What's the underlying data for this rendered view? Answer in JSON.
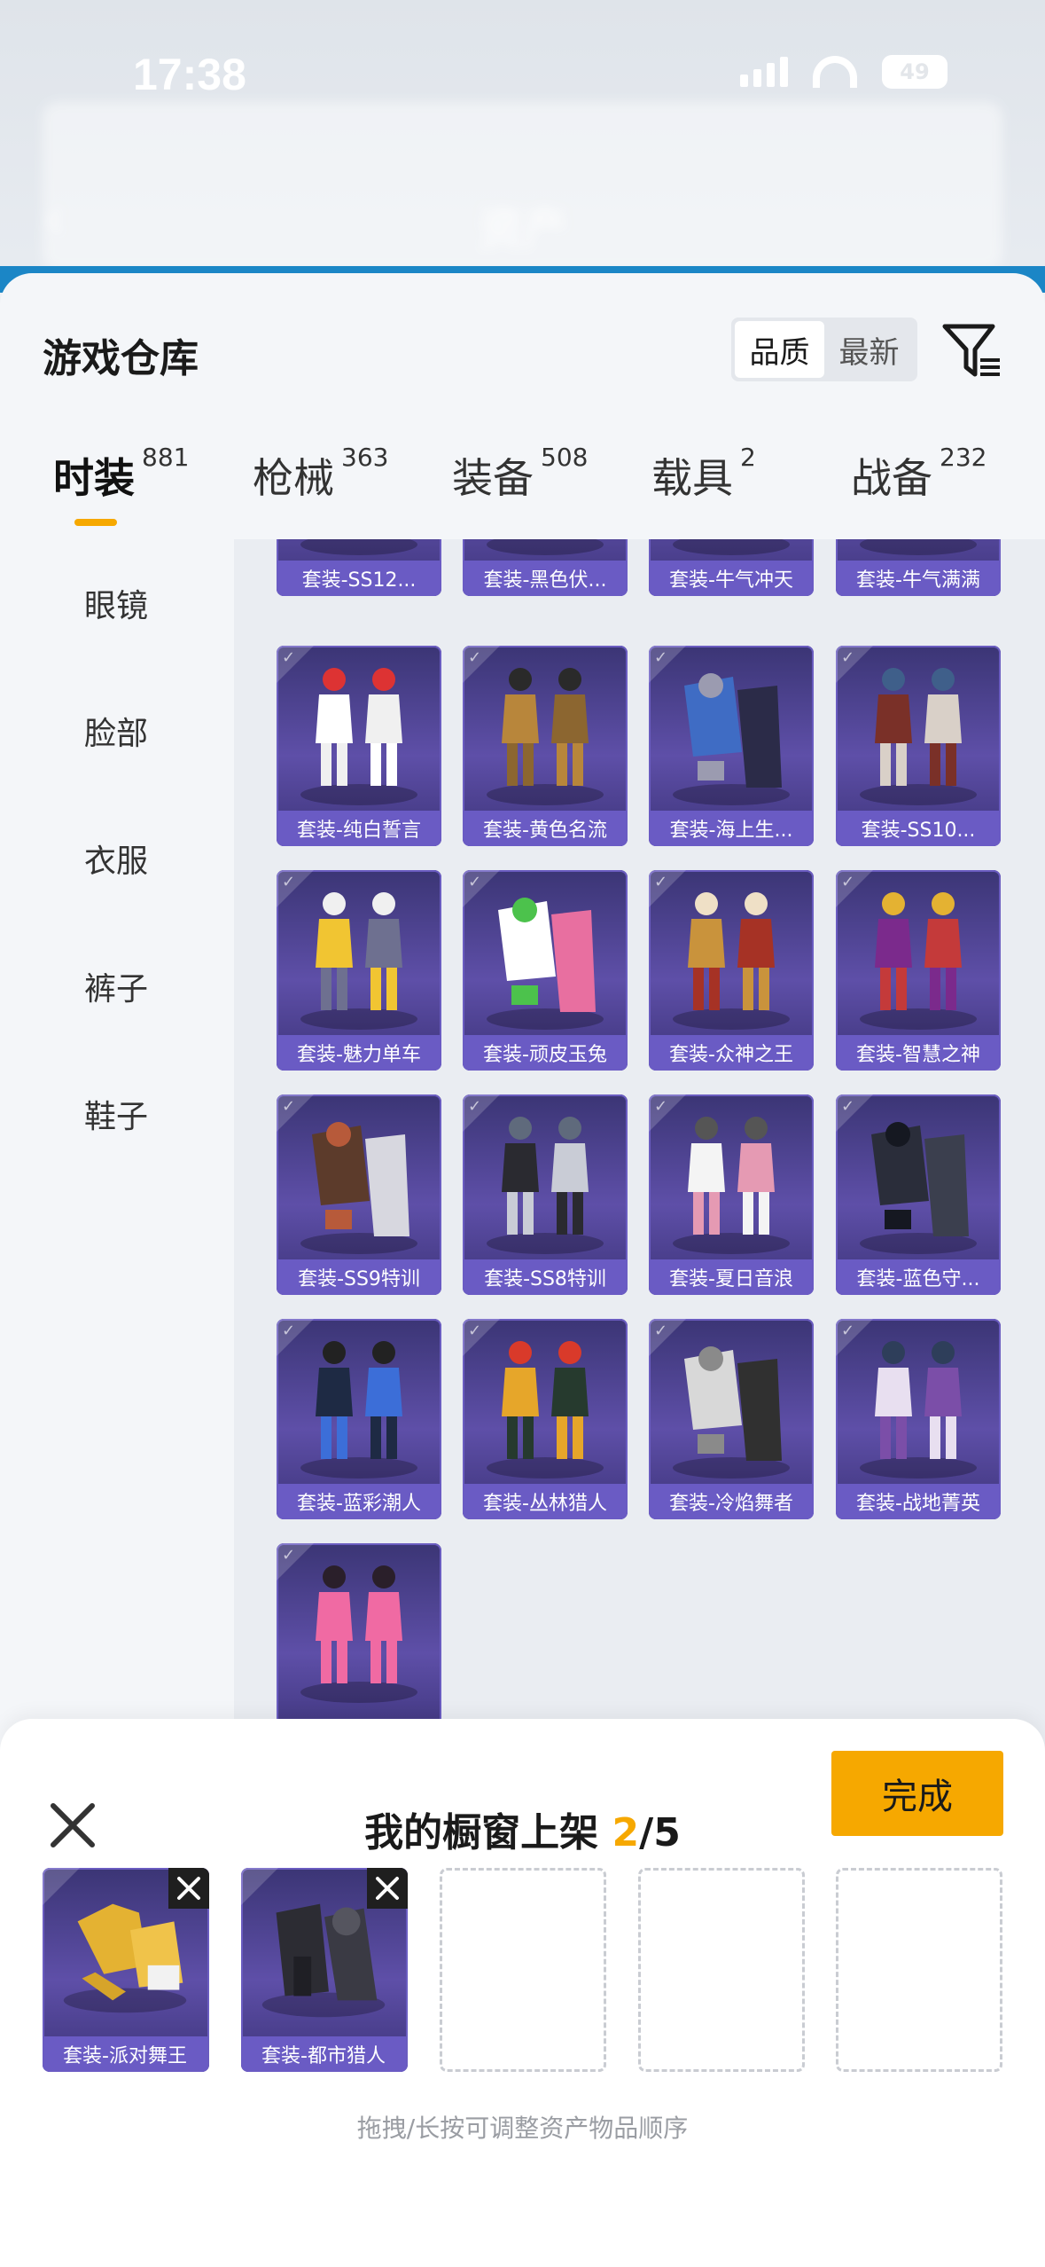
{
  "status": {
    "time": "17:38",
    "battery": "49"
  },
  "background": {
    "page_title": "资产"
  },
  "header": {
    "title": "游戏仓库",
    "sort_options": [
      "品质",
      "最新"
    ],
    "active_sort": "品质"
  },
  "tabs": [
    {
      "label": "时装",
      "count": "881",
      "active": true
    },
    {
      "label": "枪械",
      "count": "363"
    },
    {
      "label": "装备",
      "count": "508"
    },
    {
      "label": "载具",
      "count": "2"
    },
    {
      "label": "战备",
      "count": "232"
    }
  ],
  "categories": [
    "眼镜",
    "脸部",
    "衣服",
    "裤子",
    "鞋子"
  ],
  "items_row0": [
    "套装-SS12...",
    "套装-黑色伏...",
    "套装-牛气冲天",
    "套装-牛气满满"
  ],
  "items": [
    "套装-纯白誓言",
    "套装-黄色名流",
    "套装-海上生...",
    "套装-SS10...",
    "套装-魅力单车",
    "套装-顽皮玉兔",
    "套装-众神之王",
    "套装-智慧之神",
    "套装-SS9特训",
    "套装-SS8特训",
    "套装-夏日音浪",
    "套装-蓝色守...",
    "套装-蓝彩潮人",
    "套装-丛林猎人",
    "套装-冷焰舞者",
    "套装-战地菁英"
  ],
  "showcase": {
    "title": "我的橱窗上架",
    "count_current": "2",
    "count_total": "/5",
    "done_label": "完成",
    "slots": [
      "套装-派对舞王",
      "套装-都市猎人"
    ],
    "hint": "拖拽/长按可调整资产物品顺序"
  },
  "colors": {
    "accent": "#f6a800",
    "card": "#5e4fa8",
    "label": "#6a5bc4"
  }
}
